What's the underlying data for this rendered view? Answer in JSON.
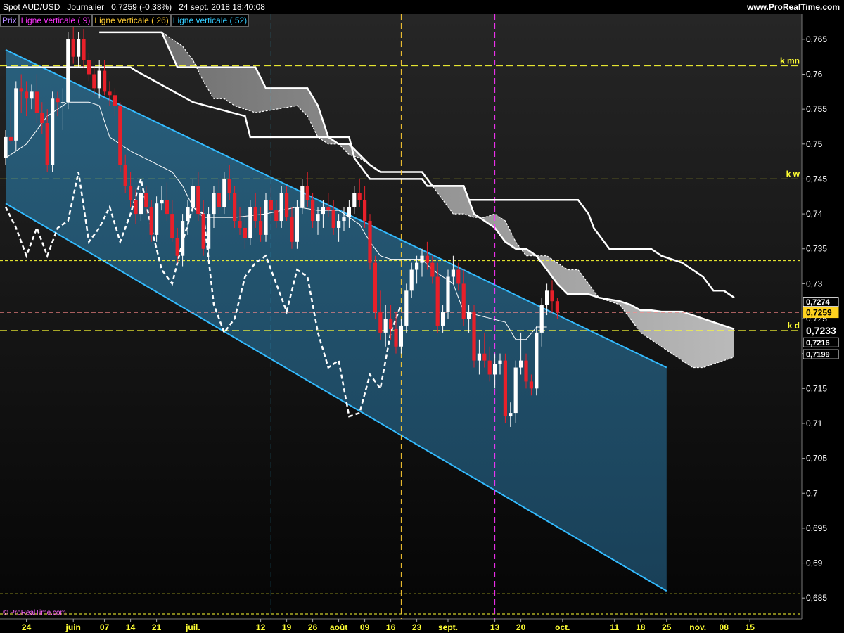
{
  "header": {
    "instrument": "Spot AUD/USD",
    "period": "Journalier",
    "quote": "0,7259 (-0,38%)",
    "datetime": "24 sept. 2018 18:40:08",
    "site": "www.ProRealTime.com"
  },
  "legend": [
    {
      "label": "Prix",
      "color": "#b388ff"
    },
    {
      "label": "Ligne verticale ( 9)",
      "color": "#ff33ff"
    },
    {
      "label": "Ligne verticale ( 26)",
      "color": "#ffcc33"
    },
    {
      "label": "Ligne verticale ( 52)",
      "color": "#33ccff"
    }
  ],
  "footer": {
    "copyright": "© ProRealTime.com"
  },
  "colors": {
    "background": "#000000",
    "bull_candle": "#ffffff",
    "bear_candle": "#e8202a",
    "channel_line": "#33bbff",
    "channel_fill": "#1c4a66",
    "cloud_upper": "#8a8a8a",
    "cloud_lower": "#c8c8c8",
    "level_line": "#ffff33",
    "price_line": "#ff8a8a",
    "vline_9": "#ff33ff",
    "vline_26": "#ffcc33",
    "vline_52": "#33ccff"
  },
  "chart_data": {
    "type": "candlestick",
    "ylim": [
      0.682,
      0.767
    ],
    "y_ticks": [
      "0,765",
      "0,76",
      "0,755",
      "0,75",
      "0,745",
      "0,74",
      "0,735",
      "0,73",
      "0,725",
      "0,72",
      "0,715",
      "0,71",
      "0,705",
      "0,7",
      "0,695",
      "0,69",
      "0,685"
    ],
    "y_tick_values": [
      0.765,
      0.76,
      0.755,
      0.75,
      0.745,
      0.74,
      0.735,
      0.73,
      0.725,
      0.72,
      0.715,
      0.71,
      0.705,
      0.7,
      0.695,
      0.69,
      0.685
    ],
    "x_ticks": [
      "24",
      "juin",
      "07",
      "14",
      "21",
      "juil.",
      "12",
      "19",
      "26",
      "août",
      "09",
      "16",
      "23",
      "sept.",
      "13",
      "20",
      "oct.",
      "11",
      "18",
      "25",
      "nov.",
      "08",
      "15"
    ],
    "x_tick_index": [
      4,
      13,
      19,
      24,
      29,
      36,
      49,
      54,
      59,
      64,
      69,
      74,
      79,
      85,
      94,
      99,
      107,
      117,
      122,
      127,
      133,
      138,
      143
    ],
    "bar_count": 150,
    "candles": [
      [
        0.748,
        0.752,
        0.747,
        0.751
      ],
      [
        0.751,
        0.756,
        0.75,
        0.7505
      ],
      [
        0.7505,
        0.759,
        0.749,
        0.758
      ],
      [
        0.758,
        0.76,
        0.7545,
        0.7575
      ],
      [
        0.7575,
        0.759,
        0.754,
        0.7565
      ],
      [
        0.7565,
        0.7585,
        0.755,
        0.7575
      ],
      [
        0.7575,
        0.76,
        0.753,
        0.7545
      ],
      [
        0.7545,
        0.756,
        0.7515,
        0.753
      ],
      [
        0.753,
        0.755,
        0.746,
        0.747
      ],
      [
        0.747,
        0.7575,
        0.746,
        0.7565
      ],
      [
        0.7565,
        0.7575,
        0.754,
        0.756
      ],
      [
        0.756,
        0.758,
        0.752,
        0.756
      ],
      [
        0.756,
        0.766,
        0.755,
        0.765
      ],
      [
        0.765,
        0.767,
        0.7615,
        0.7625
      ],
      [
        0.7625,
        0.766,
        0.761,
        0.765
      ],
      [
        0.765,
        0.7665,
        0.761,
        0.762
      ],
      [
        0.762,
        0.763,
        0.759,
        0.76
      ],
      [
        0.76,
        0.761,
        0.757,
        0.758
      ],
      [
        0.758,
        0.762,
        0.7565,
        0.7605
      ],
      [
        0.7605,
        0.762,
        0.757,
        0.7575
      ],
      [
        0.7575,
        0.759,
        0.7555,
        0.757
      ],
      [
        0.757,
        0.758,
        0.754,
        0.7555
      ],
      [
        0.7555,
        0.756,
        0.746,
        0.747
      ],
      [
        0.747,
        0.7485,
        0.743,
        0.744
      ],
      [
        0.744,
        0.746,
        0.741,
        0.742
      ],
      [
        0.742,
        0.7435,
        0.7385,
        0.74
      ],
      [
        0.74,
        0.744,
        0.739,
        0.743
      ],
      [
        0.743,
        0.744,
        0.74,
        0.741
      ],
      [
        0.741,
        0.742,
        0.736,
        0.737
      ],
      [
        0.737,
        0.7425,
        0.736,
        0.7415
      ],
      [
        0.7415,
        0.744,
        0.7405,
        0.742
      ],
      [
        0.742,
        0.7445,
        0.739,
        0.74
      ],
      [
        0.74,
        0.742,
        0.736,
        0.7365
      ],
      [
        0.7365,
        0.738,
        0.733,
        0.734
      ],
      [
        0.734,
        0.74,
        0.7325,
        0.739
      ],
      [
        0.739,
        0.742,
        0.737,
        0.741
      ],
      [
        0.741,
        0.745,
        0.74,
        0.744
      ],
      [
        0.744,
        0.746,
        0.739,
        0.74
      ],
      [
        0.74,
        0.742,
        0.734,
        0.735
      ],
      [
        0.735,
        0.741,
        0.733,
        0.74
      ],
      [
        0.74,
        0.744,
        0.738,
        0.743
      ],
      [
        0.743,
        0.745,
        0.74,
        0.741
      ],
      [
        0.741,
        0.746,
        0.74,
        0.745
      ],
      [
        0.745,
        0.747,
        0.742,
        0.743
      ],
      [
        0.743,
        0.744,
        0.738,
        0.739
      ],
      [
        0.739,
        0.741,
        0.737,
        0.738
      ],
      [
        0.738,
        0.74,
        0.735,
        0.7365
      ],
      [
        0.7365,
        0.742,
        0.7355,
        0.741
      ],
      [
        0.741,
        0.743,
        0.738,
        0.739
      ],
      [
        0.739,
        0.741,
        0.736,
        0.737
      ],
      [
        0.737,
        0.743,
        0.736,
        0.742
      ],
      [
        0.742,
        0.744,
        0.7395,
        0.7405
      ],
      [
        0.7405,
        0.742,
        0.738,
        0.739
      ],
      [
        0.739,
        0.744,
        0.738,
        0.743
      ],
      [
        0.743,
        0.744,
        0.739,
        0.7395
      ],
      [
        0.7395,
        0.741,
        0.735,
        0.736
      ],
      [
        0.736,
        0.742,
        0.735,
        0.741
      ],
      [
        0.741,
        0.745,
        0.74,
        0.744
      ],
      [
        0.744,
        0.746,
        0.741,
        0.742
      ],
      [
        0.742,
        0.743,
        0.738,
        0.739
      ],
      [
        0.739,
        0.741,
        0.737,
        0.74
      ],
      [
        0.74,
        0.742,
        0.738,
        0.741
      ],
      [
        0.741,
        0.743,
        0.7395,
        0.7405
      ],
      [
        0.7405,
        0.742,
        0.737,
        0.738
      ],
      [
        0.738,
        0.74,
        0.736,
        0.739
      ],
      [
        0.739,
        0.741,
        0.7375,
        0.7395
      ],
      [
        0.7395,
        0.742,
        0.738,
        0.741
      ],
      [
        0.741,
        0.744,
        0.74,
        0.743
      ],
      [
        0.743,
        0.745,
        0.741,
        0.742
      ],
      [
        0.742,
        0.744,
        0.738,
        0.739
      ],
      [
        0.739,
        0.74,
        0.732,
        0.733
      ],
      [
        0.733,
        0.734,
        0.725,
        0.726
      ],
      [
        0.726,
        0.729,
        0.722,
        0.723
      ],
      [
        0.723,
        0.727,
        0.721,
        0.725
      ],
      [
        0.725,
        0.727,
        0.722,
        0.7235
      ],
      [
        0.7235,
        0.726,
        0.72,
        0.721
      ],
      [
        0.721,
        0.725,
        0.72,
        0.724
      ],
      [
        0.724,
        0.73,
        0.723,
        0.729
      ],
      [
        0.729,
        0.733,
        0.728,
        0.732
      ],
      [
        0.732,
        0.734,
        0.73,
        0.733
      ],
      [
        0.733,
        0.735,
        0.731,
        0.734
      ],
      [
        0.734,
        0.736,
        0.732,
        0.733
      ],
      [
        0.733,
        0.734,
        0.73,
        0.731
      ],
      [
        0.731,
        0.733,
        0.723,
        0.724
      ],
      [
        0.724,
        0.727,
        0.723,
        0.726
      ],
      [
        0.726,
        0.732,
        0.725,
        0.731
      ],
      [
        0.731,
        0.734,
        0.73,
        0.732
      ],
      [
        0.732,
        0.733,
        0.729,
        0.73
      ],
      [
        0.73,
        0.732,
        0.724,
        0.725
      ],
      [
        0.725,
        0.727,
        0.723,
        0.726
      ],
      [
        0.726,
        0.727,
        0.718,
        0.719
      ],
      [
        0.719,
        0.722,
        0.717,
        0.72
      ],
      [
        0.72,
        0.723,
        0.718,
        0.719
      ],
      [
        0.719,
        0.721,
        0.716,
        0.717
      ],
      [
        0.717,
        0.72,
        0.715,
        0.7185
      ],
      [
        0.7185,
        0.72,
        0.717,
        0.719
      ],
      [
        0.719,
        0.72,
        0.71,
        0.711
      ],
      [
        0.711,
        0.713,
        0.7095,
        0.7115
      ],
      [
        0.7115,
        0.719,
        0.71,
        0.718
      ],
      [
        0.718,
        0.723,
        0.717,
        0.719
      ],
      [
        0.719,
        0.72,
        0.715,
        0.716
      ],
      [
        0.716,
        0.717,
        0.714,
        0.715
      ],
      [
        0.715,
        0.724,
        0.714,
        0.723
      ],
      [
        0.723,
        0.728,
        0.721,
        0.727
      ],
      [
        0.727,
        0.73,
        0.7255,
        0.729
      ],
      [
        0.729,
        0.7305,
        0.726,
        0.7275
      ],
      [
        0.7275,
        0.728,
        0.725,
        0.7259
      ]
    ],
    "kijun": [
      [
        0,
        0.761
      ],
      [
        24,
        0.761
      ],
      [
        25,
        0.7605
      ],
      [
        36,
        0.756
      ],
      [
        46,
        0.754
      ],
      [
        47,
        0.751
      ],
      [
        66,
        0.751
      ],
      [
        67,
        0.748
      ],
      [
        70,
        0.745
      ],
      [
        80,
        0.745
      ],
      [
        81,
        0.744
      ],
      [
        88,
        0.744
      ],
      [
        89,
        0.742
      ],
      [
        110,
        0.742
      ],
      [
        112,
        0.74
      ],
      [
        113,
        0.738
      ],
      [
        116,
        0.735
      ],
      [
        124,
        0.735
      ],
      [
        126,
        0.734
      ],
      [
        130,
        0.733
      ],
      [
        134,
        0.731
      ],
      [
        136,
        0.729
      ],
      [
        138,
        0.729
      ],
      [
        140,
        0.728
      ]
    ],
    "tenkan": [
      [
        0,
        0.748
      ],
      [
        4,
        0.75
      ],
      [
        8,
        0.754
      ],
      [
        12,
        0.756
      ],
      [
        16,
        0.756
      ],
      [
        18,
        0.7555
      ],
      [
        20,
        0.751
      ],
      [
        24,
        0.749
      ],
      [
        28,
        0.7475
      ],
      [
        32,
        0.746
      ],
      [
        34,
        0.744
      ],
      [
        36,
        0.741
      ],
      [
        38,
        0.7395
      ],
      [
        44,
        0.7395
      ],
      [
        50,
        0.74
      ],
      [
        56,
        0.741
      ],
      [
        60,
        0.7405
      ],
      [
        64,
        0.7405
      ],
      [
        66,
        0.7395
      ],
      [
        68,
        0.7385
      ],
      [
        70,
        0.736
      ],
      [
        72,
        0.734
      ],
      [
        74,
        0.7335
      ],
      [
        80,
        0.7335
      ],
      [
        82,
        0.732
      ],
      [
        86,
        0.73
      ],
      [
        88,
        0.726
      ],
      [
        96,
        0.7245
      ],
      [
        98,
        0.722
      ],
      [
        100,
        0.722
      ],
      [
        102,
        0.7238
      ],
      [
        104,
        0.7238
      ]
    ],
    "chikou": [
      [
        0,
        0.741
      ],
      [
        2,
        0.738
      ],
      [
        4,
        0.734
      ],
      [
        6,
        0.738
      ],
      [
        8,
        0.734
      ],
      [
        10,
        0.738
      ],
      [
        12,
        0.739
      ],
      [
        14,
        0.746
      ],
      [
        16,
        0.736
      ],
      [
        18,
        0.738
      ],
      [
        20,
        0.741
      ],
      [
        22,
        0.736
      ],
      [
        24,
        0.74
      ],
      [
        26,
        0.745
      ],
      [
        28,
        0.738
      ],
      [
        30,
        0.732
      ],
      [
        32,
        0.73
      ],
      [
        34,
        0.736
      ],
      [
        36,
        0.741
      ],
      [
        38,
        0.74
      ],
      [
        40,
        0.727
      ],
      [
        42,
        0.723
      ],
      [
        44,
        0.725
      ],
      [
        46,
        0.731
      ],
      [
        48,
        0.733
      ],
      [
        50,
        0.734
      ],
      [
        52,
        0.73
      ],
      [
        54,
        0.726
      ],
      [
        56,
        0.732
      ],
      [
        58,
        0.731
      ],
      [
        60,
        0.723
      ],
      [
        62,
        0.718
      ],
      [
        64,
        0.719
      ],
      [
        66,
        0.711
      ],
      [
        68,
        0.7115
      ],
      [
        70,
        0.717
      ],
      [
        72,
        0.715
      ],
      [
        74,
        0.723
      ],
      [
        76,
        0.727
      ]
    ],
    "cloud_a": [
      [
        18,
        0.766
      ],
      [
        30,
        0.766
      ],
      [
        34,
        0.764
      ],
      [
        36,
        0.762
      ],
      [
        38,
        0.759
      ],
      [
        40,
        0.7565
      ],
      [
        42,
        0.7565
      ],
      [
        44,
        0.7555
      ],
      [
        48,
        0.7545
      ],
      [
        52,
        0.755
      ],
      [
        56,
        0.7555
      ],
      [
        58,
        0.754
      ],
      [
        60,
        0.751
      ],
      [
        62,
        0.75
      ],
      [
        64,
        0.75
      ],
      [
        66,
        0.7485
      ],
      [
        68,
        0.748
      ],
      [
        72,
        0.746
      ],
      [
        80,
        0.746
      ],
      [
        82,
        0.744
      ],
      [
        84,
        0.742
      ],
      [
        86,
        0.74
      ],
      [
        88,
        0.74
      ],
      [
        90,
        0.7395
      ],
      [
        92,
        0.7395
      ],
      [
        94,
        0.74
      ],
      [
        96,
        0.739
      ],
      [
        98,
        0.736
      ],
      [
        100,
        0.734
      ],
      [
        104,
        0.734
      ],
      [
        106,
        0.733
      ],
      [
        108,
        0.732
      ],
      [
        110,
        0.732
      ],
      [
        112,
        0.73
      ],
      [
        114,
        0.728
      ],
      [
        118,
        0.727
      ],
      [
        120,
        0.725
      ],
      [
        122,
        0.723
      ],
      [
        124,
        0.722
      ],
      [
        126,
        0.721
      ],
      [
        128,
        0.72
      ],
      [
        130,
        0.719
      ],
      [
        132,
        0.718
      ],
      [
        134,
        0.718
      ],
      [
        136,
        0.7185
      ],
      [
        138,
        0.719
      ],
      [
        140,
        0.7195
      ]
    ],
    "cloud_b": [
      [
        18,
        0.766
      ],
      [
        30,
        0.766
      ],
      [
        33,
        0.761
      ],
      [
        48,
        0.761
      ],
      [
        50,
        0.758
      ],
      [
        58,
        0.758
      ],
      [
        60,
        0.7555
      ],
      [
        62,
        0.751
      ],
      [
        64,
        0.75
      ],
      [
        66,
        0.75
      ],
      [
        68,
        0.7485
      ],
      [
        70,
        0.747
      ],
      [
        72,
        0.746
      ],
      [
        80,
        0.746
      ],
      [
        82,
        0.744
      ],
      [
        86,
        0.744
      ],
      [
        88,
        0.744
      ],
      [
        90,
        0.74
      ],
      [
        94,
        0.738
      ],
      [
        96,
        0.736
      ],
      [
        98,
        0.735
      ],
      [
        100,
        0.735
      ],
      [
        102,
        0.734
      ],
      [
        104,
        0.732
      ],
      [
        106,
        0.73
      ],
      [
        108,
        0.7285
      ],
      [
        112,
        0.7285
      ],
      [
        114,
        0.728
      ],
      [
        118,
        0.7275
      ],
      [
        120,
        0.727
      ],
      [
        122,
        0.7262
      ],
      [
        124,
        0.7262
      ],
      [
        126,
        0.726
      ],
      [
        130,
        0.726
      ],
      [
        134,
        0.725
      ],
      [
        138,
        0.724
      ],
      [
        140,
        0.7235
      ]
    ],
    "channel": {
      "upper": [
        [
          0,
          0.7635
        ],
        [
          127,
          0.718
        ]
      ],
      "lower": [
        [
          0,
          0.7415
        ],
        [
          127,
          0.686
        ]
      ]
    },
    "h_levels": [
      {
        "y": 0.7612,
        "label": "k mn",
        "style": "dash-long"
      },
      {
        "y": 0.745,
        "label": "k w",
        "style": "dash-long"
      },
      {
        "y": 0.7333,
        "label": "",
        "style": "dash-short"
      },
      {
        "y": 0.7233,
        "label": "k d",
        "style": "dash-long"
      },
      {
        "y": 0.6856,
        "label": "",
        "style": "dash-short"
      },
      {
        "y": 0.6827,
        "label": "",
        "style": "dash-short"
      }
    ],
    "current_price": 0.7259,
    "price_labels": [
      {
        "text": "0,7274",
        "y": 0.7274,
        "style": "plain"
      },
      {
        "text": "0,7259",
        "y": 0.7259,
        "style": "highlight"
      },
      {
        "text": "0,7233",
        "y": 0.7233,
        "style": "large"
      },
      {
        "text": "0,7216",
        "y": 0.7216,
        "style": "plain"
      },
      {
        "text": "0,7199",
        "y": 0.7199,
        "style": "plain"
      }
    ],
    "vlines": [
      {
        "bar": 51,
        "color_key": "vline_52"
      },
      {
        "bar": 76,
        "color_key": "vline_26"
      },
      {
        "bar": 94,
        "color_key": "vline_9"
      }
    ]
  }
}
